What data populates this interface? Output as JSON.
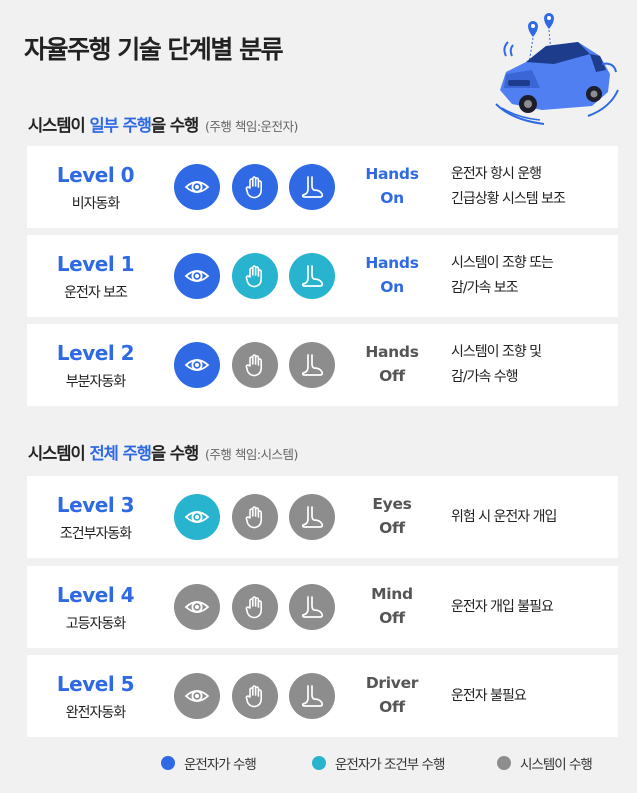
{
  "title": "자율주행 기술 단계별 분류",
  "colors": {
    "driver": "#2f6ae4",
    "conditional": "#28b3cf",
    "system": "#8d8d8d",
    "background": "#f1f1f1"
  },
  "sections": [
    {
      "pre": "시스템이 ",
      "highlight": "일부 주행",
      "post": "을 수행",
      "note": "(주행 책임:운전자)"
    },
    {
      "pre": "시스템이 ",
      "highlight": "전체 주행",
      "post": "을 수행",
      "note": "(주행 책임:시스템)"
    }
  ],
  "levels": [
    {
      "level": "Level 0",
      "name": "비자동화",
      "icons": [
        "driver",
        "driver",
        "driver"
      ],
      "hands1": "Hands",
      "hands2": "On",
      "desc1": "운전자 항시 운행",
      "desc2": "긴급상황 시스템 보조"
    },
    {
      "level": "Level 1",
      "name": "운전자 보조",
      "icons": [
        "driver",
        "conditional",
        "conditional"
      ],
      "hands1": "Hands",
      "hands2": "On",
      "desc1": "시스템이 조향 또는",
      "desc2": "감/가속 보조"
    },
    {
      "level": "Level 2",
      "name": "부분자동화",
      "icons": [
        "driver",
        "system",
        "system"
      ],
      "hands1": "Hands",
      "hands2": "Off",
      "desc1": "시스템이 조향 및",
      "desc2": "감/가속 수행"
    },
    {
      "level": "Level 3",
      "name": "조건부자동화",
      "icons": [
        "conditional",
        "system",
        "system"
      ],
      "hands1": "Eyes",
      "hands2": "Off",
      "desc1": "위험 시 운전자 개입",
      "desc2": ""
    },
    {
      "level": "Level 4",
      "name": "고등자동화",
      "icons": [
        "system",
        "system",
        "system"
      ],
      "hands1": "Mind",
      "hands2": "Off",
      "desc1": "운전자 개입 불필요",
      "desc2": ""
    },
    {
      "level": "Level 5",
      "name": "완전자동화",
      "icons": [
        "system",
        "system",
        "system"
      ],
      "hands1": "Driver",
      "hands2": "Off",
      "desc1": "운전자 불필요",
      "desc2": ""
    }
  ],
  "icon_names": [
    "eye-icon",
    "hand-icon",
    "foot-icon"
  ],
  "legend": [
    {
      "label": "운전자가 수행",
      "color": "driver"
    },
    {
      "label": "운전자가 조건부 수행",
      "color": "conditional"
    },
    {
      "label": "시스템이 수행",
      "color": "system"
    }
  ]
}
